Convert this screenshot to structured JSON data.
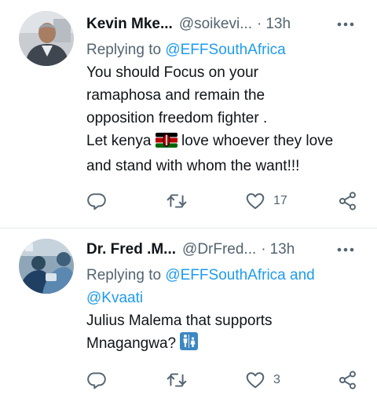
{
  "tweets": [
    {
      "name": "Kevin Mke...",
      "handle": "@soikevi...",
      "separator": "·",
      "time": "13h",
      "replying_prefix": "Replying to",
      "replying_mentions": "@EFFSouthAfrica",
      "body_lines": [
        "You should Focus on your",
        "ramaphosa and remain the",
        "opposition freedom fighter .",
        "Let kenya",
        "love whoever they love",
        "and stand with whom the want!!!"
      ],
      "emoji_icon": "kenya-flag-icon",
      "reply_count": "",
      "retweet_count": "",
      "like_count": "17"
    },
    {
      "name": "Dr. Fred .M...",
      "handle": "@DrFred...",
      "separator": "·",
      "time": "13h",
      "replying_prefix": "Replying to",
      "replying_mentions": "@EFFSouthAfrica and",
      "replying_mentions_2": "@Kvaati",
      "body_lines": [
        "Julius Malema that supports",
        "Mnagangwa?"
      ],
      "emoji_icon": "restroom-icon",
      "reply_count": "",
      "retweet_count": "",
      "like_count": "3"
    }
  ],
  "colors": {
    "text": "#0f1419",
    "secondary": "#536471",
    "link": "#1d9bf0",
    "divider": "#e1e8ed"
  },
  "icons": {
    "more": "more-options-icon",
    "reply": "reply-icon",
    "retweet": "retweet-icon",
    "like": "heart-icon",
    "share": "share-icon"
  }
}
